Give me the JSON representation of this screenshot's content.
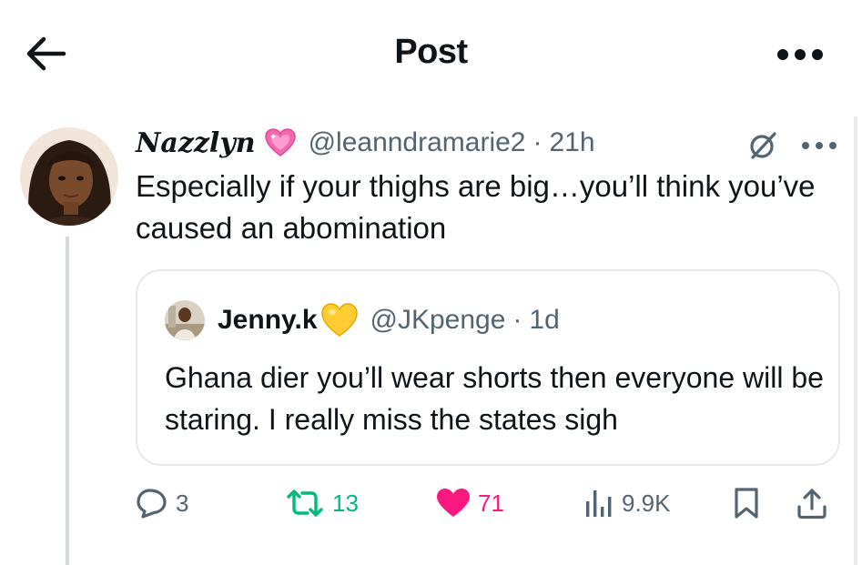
{
  "header": {
    "title": "Post",
    "back_icon": "arrow-left-icon",
    "more_icon": "more-horizontal-icon"
  },
  "post": {
    "display_name": "Nazzlyn",
    "name_emoji": "sparkling-heart",
    "handle": "@leanndramarie2",
    "separator": "·",
    "time": "21h",
    "text": "Especially if your thighs are big…you’ll think you’ve caused an abomination",
    "quote": {
      "display_name": "Jenny.k",
      "name_emoji": "yellow-heart",
      "handle": "@JKpenge",
      "separator": "·",
      "time": "1d",
      "text": "Ghana dier you’ll wear shorts then everyone will be staring. I really miss the states sigh"
    },
    "stats": {
      "replies": "3",
      "reposts": "13",
      "likes": "71",
      "views": "9.9K"
    }
  },
  "colors": {
    "text": "#0f1419",
    "secondary": "#536471",
    "repost": "#00ba7c",
    "like": "#f91880",
    "border": "#e4e8eb"
  }
}
